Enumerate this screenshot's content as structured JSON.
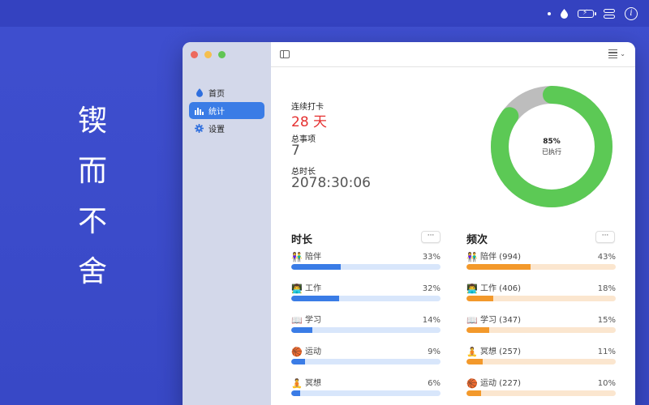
{
  "slogan": [
    "锲",
    "而",
    "不",
    "舍"
  ],
  "sidebar": {
    "items": [
      {
        "label": "首页",
        "icon": "drop-icon",
        "active": false
      },
      {
        "label": "统计",
        "icon": "chart-icon",
        "active": true
      },
      {
        "label": "设置",
        "icon": "gear-icon",
        "active": false
      }
    ]
  },
  "stats": {
    "streak_label": "连续打卡",
    "streak_value": "28 天",
    "items_label": "总事项",
    "items_value": "7",
    "duration_label": "总时长",
    "duration_value": "2078:30:06"
  },
  "donut": {
    "percent": 85,
    "percent_text": "85%",
    "sub_label": "已执行",
    "color_done": "#5cc955",
    "color_rest": "#bdbdbd"
  },
  "duration_section": {
    "title": "时长",
    "more": "···",
    "rows": [
      {
        "emoji": "👫",
        "label": "陪伴",
        "pct_text": "33%",
        "value": 33
      },
      {
        "emoji": "👨‍💻",
        "label": "工作",
        "pct_text": "32%",
        "value": 32
      },
      {
        "emoji": "📖",
        "label": "学习",
        "pct_text": "14%",
        "value": 14
      },
      {
        "emoji": "🏀",
        "label": "运动",
        "pct_text": "9%",
        "value": 9
      },
      {
        "emoji": "🧘",
        "label": "冥想",
        "pct_text": "6%",
        "value": 6
      }
    ]
  },
  "frequency_section": {
    "title": "频次",
    "more": "···",
    "rows": [
      {
        "emoji": "👫",
        "label": "陪伴 (994)",
        "pct_text": "43%",
        "value": 43
      },
      {
        "emoji": "👨‍💻",
        "label": "工作 (406)",
        "pct_text": "18%",
        "value": 18
      },
      {
        "emoji": "📖",
        "label": "学习 (347)",
        "pct_text": "15%",
        "value": 15
      },
      {
        "emoji": "🧘",
        "label": "冥想 (257)",
        "pct_text": "11%",
        "value": 11
      },
      {
        "emoji": "🏀",
        "label": "运动 (227)",
        "pct_text": "10%",
        "value": 10
      }
    ]
  },
  "colors": {
    "accent": "#3a7ce6",
    "frequency": "#f3992b",
    "streak": "#e53030"
  }
}
